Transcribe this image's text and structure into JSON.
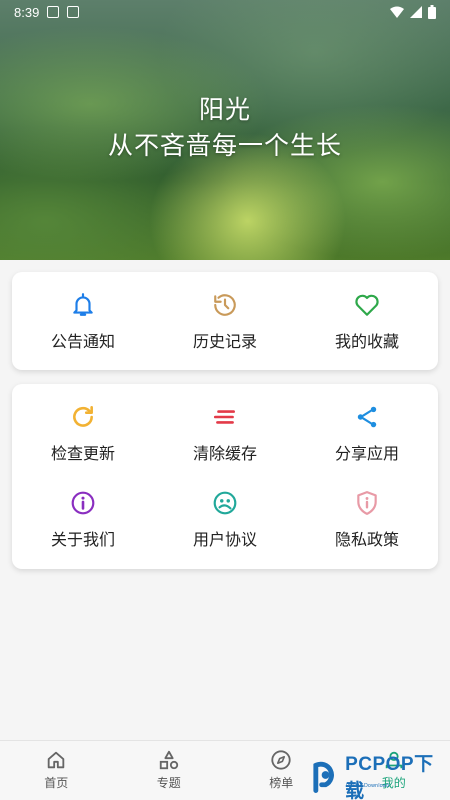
{
  "status": {
    "time": "8:39"
  },
  "hero": {
    "line1": "阳光",
    "line2": "从不吝啬每一个生长"
  },
  "card1": [
    {
      "label": "公告通知",
      "icon": "bell-icon",
      "color": "#1e7ee8"
    },
    {
      "label": "历史记录",
      "icon": "history-icon",
      "color": "#c99a5a"
    },
    {
      "label": "我的收藏",
      "icon": "heart-icon",
      "color": "#2ea84a"
    }
  ],
  "card2": [
    {
      "label": "检查更新",
      "icon": "refresh-icon",
      "color": "#f2b233"
    },
    {
      "label": "清除缓存",
      "icon": "clear-icon",
      "color": "#e33a48"
    },
    {
      "label": "分享应用",
      "icon": "share-icon",
      "color": "#1e8ee0"
    },
    {
      "label": "关于我们",
      "icon": "info-icon",
      "color": "#8a2ec0"
    },
    {
      "label": "用户协议",
      "icon": "face-icon",
      "color": "#21a89a"
    },
    {
      "label": "隐私政策",
      "icon": "shield-info-icon",
      "color": "#e89aa6"
    }
  ],
  "nav": [
    {
      "label": "首页",
      "icon": "home-icon"
    },
    {
      "label": "专题",
      "icon": "shapes-icon"
    },
    {
      "label": "榜单",
      "icon": "compass-icon"
    },
    {
      "label": "我的",
      "icon": "person-icon",
      "active": true
    }
  ],
  "watermark": {
    "text": "PCPOP下载",
    "sub": "PCPOP Download"
  }
}
